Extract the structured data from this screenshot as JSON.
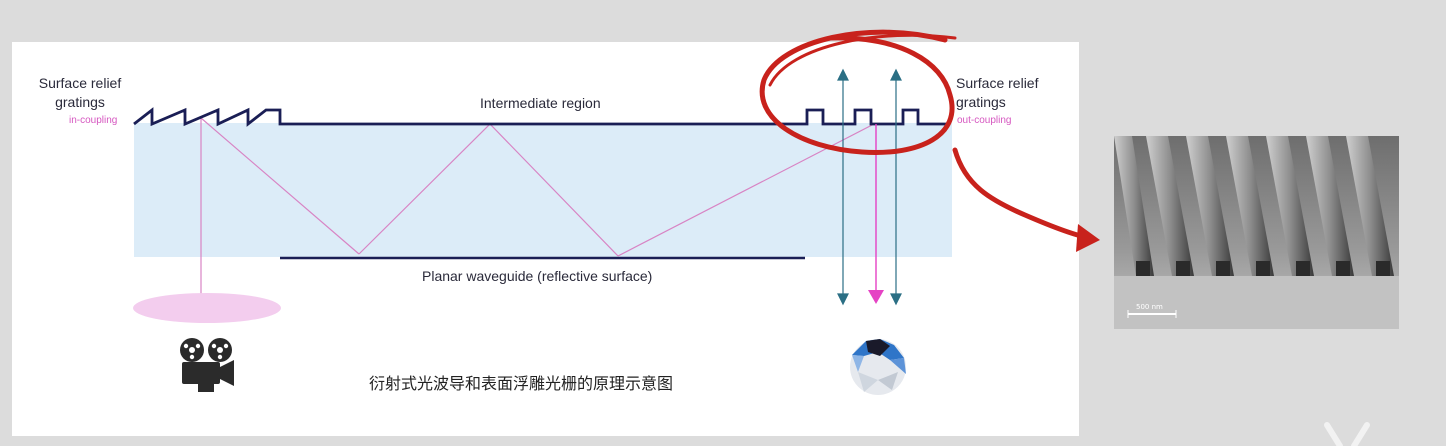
{
  "diagram": {
    "left_grating": {
      "title_line1": "Surface relief",
      "title_line2": "gratings",
      "subtitle": "in-coupling"
    },
    "right_grating": {
      "title_line1": "Surface relief",
      "title_line2": "gratings",
      "subtitle": "out-coupling"
    },
    "intermediate_label": "Intermediate region",
    "waveguide_label": "Planar waveguide (reflective surface)",
    "caption": "衍射式光波导和表面浮雕光栅的原理示意图",
    "icons": [
      "projector-icon",
      "eye-icon",
      "close-icon"
    ]
  },
  "sem_image": {
    "scale_label": "500 nm"
  },
  "colors": {
    "waveguide_fill": "#dcecf8",
    "grating_line": "#1a1e55",
    "ray": "#d884c4",
    "arrow_teal": "#2b6f85",
    "arrow_magenta": "#e542c4",
    "annotation_red": "#c8221c"
  }
}
